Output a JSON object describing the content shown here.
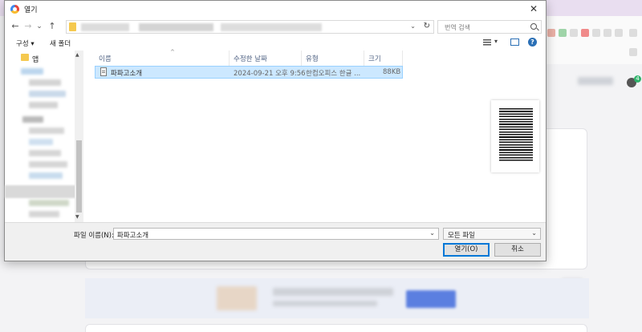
{
  "dialog": {
    "title": "열기",
    "close_glyph": "✕"
  },
  "nav": {
    "back_glyph": "←",
    "forward_glyph": "→",
    "recent_glyph": "⌄",
    "up_glyph": "↑",
    "refresh_glyph": "↻",
    "dropdown_glyph": "⌄",
    "search_placeholder": "번역 검색"
  },
  "toolbar": {
    "organize_label": "구성 ▾",
    "new_folder_label": "새 폴더",
    "help_glyph": "?",
    "view_dropdown_glyph": "▾"
  },
  "nav_pane": {
    "first_item": "앱",
    "scroll_up_glyph": "▲",
    "scroll_down_glyph": "▼"
  },
  "columns": {
    "name": "이름",
    "modified": "수정한 날짜",
    "type": "유형",
    "size": "크기",
    "sort_glyph": "^"
  },
  "files": [
    {
      "name": "파파고소개",
      "modified": "2024-09-21 오후 9:56",
      "type": "한컴오피스 한글 ...",
      "size": "88KB"
    }
  ],
  "bottom": {
    "filename_label": "파일 이름(N):",
    "filename_value": "파파고소개",
    "filename_dropdown_glyph": "⌄",
    "filetype_value": "모든 파일",
    "filetype_dropdown_glyph": "⌄",
    "open_label": "열기(O)",
    "cancel_label": "취소"
  },
  "background": {
    "chat_badge": "4"
  }
}
